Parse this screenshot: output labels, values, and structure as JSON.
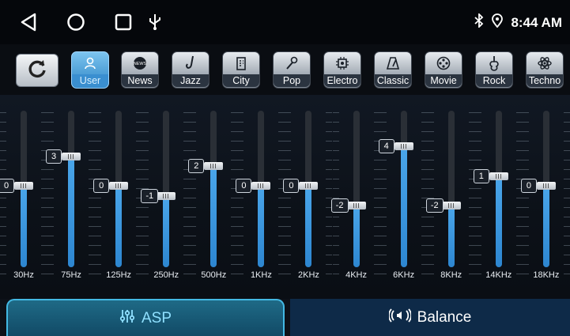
{
  "status": {
    "time": "8:44 AM"
  },
  "icons": {
    "back": "back-triangle-icon",
    "home": "home-circle-icon",
    "recents": "recents-square-icon",
    "usb": "usb-icon",
    "bluetooth": "bluetooth-icon",
    "location": "location-pin-icon",
    "reset": "refresh-icon"
  },
  "presets": [
    {
      "label": "User",
      "icon": "user-icon",
      "active": true
    },
    {
      "label": "News",
      "icon": "news-icon",
      "active": false
    },
    {
      "label": "Jazz",
      "icon": "saxophone-icon",
      "active": false
    },
    {
      "label": "City",
      "icon": "building-icon",
      "active": false
    },
    {
      "label": "Pop",
      "icon": "microphone-icon",
      "active": false
    },
    {
      "label": "Electro",
      "icon": "chip-icon",
      "active": false
    },
    {
      "label": "Classic",
      "icon": "metronome-icon",
      "active": false
    },
    {
      "label": "Movie",
      "icon": "film-reel-icon",
      "active": false
    },
    {
      "label": "Rock",
      "icon": "guitar-icon",
      "active": false
    },
    {
      "label": "Techno",
      "icon": "atom-icon",
      "active": false
    }
  ],
  "eq": {
    "range": [
      -7,
      7
    ],
    "bands": [
      {
        "freq": "30Hz",
        "value": "0"
      },
      {
        "freq": "75Hz",
        "value": "3"
      },
      {
        "freq": "125Hz",
        "value": "0"
      },
      {
        "freq": "250Hz",
        "value": "-1"
      },
      {
        "freq": "500Hz",
        "value": "2"
      },
      {
        "freq": "1KHz",
        "value": "0"
      },
      {
        "freq": "2KHz",
        "value": "0"
      },
      {
        "freq": "4KHz",
        "value": "-2"
      },
      {
        "freq": "6KHz",
        "value": "4"
      },
      {
        "freq": "8KHz",
        "value": "-2"
      },
      {
        "freq": "14KHz",
        "value": "1"
      },
      {
        "freq": "18KHz",
        "value": "0"
      }
    ]
  },
  "tabs": {
    "asp": {
      "label": "ASP",
      "icon": "sliders-icon"
    },
    "balance": {
      "label": "Balance",
      "icon": "speaker-icon"
    }
  },
  "colors": {
    "accent": "#3a8fd0",
    "fill": "#2d86d0",
    "active_tab": "#43b9e4"
  }
}
